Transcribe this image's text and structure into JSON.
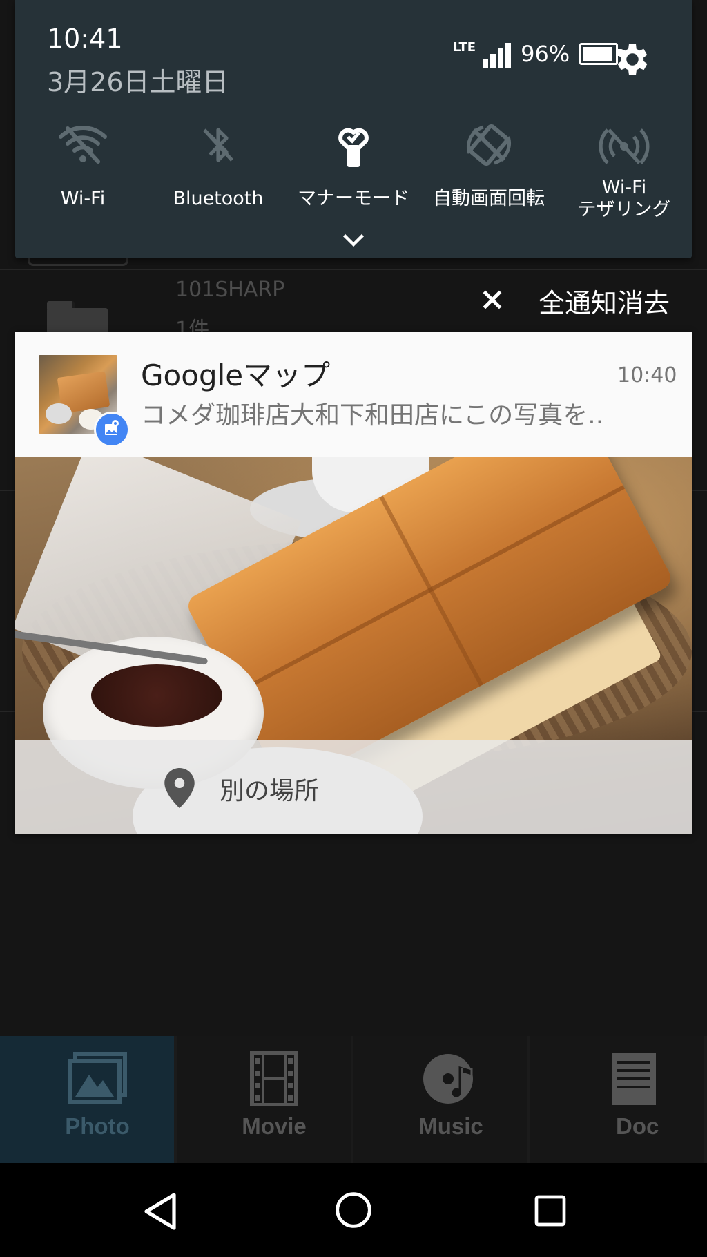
{
  "status": {
    "time": "10:41",
    "date": "3月26日土曜日",
    "network": "LTE",
    "battery_percent": "96%",
    "battery_level": 0.96
  },
  "quick_settings": {
    "tiles": [
      {
        "label": "Wi-Fi",
        "icon": "wifi-off-icon",
        "state": "off"
      },
      {
        "label": "Bluetooth",
        "icon": "bluetooth-off-icon",
        "state": "off"
      },
      {
        "label": "マナーモード",
        "icon": "manner-mode-icon",
        "state": "on"
      },
      {
        "label": "自動画面回転",
        "icon": "auto-rotate-off-icon",
        "state": "off"
      },
      {
        "label_line1": "Wi-Fi",
        "label_line2": "テザリング",
        "icon": "wifi-tethering-off-icon",
        "state": "off"
      }
    ]
  },
  "background_list": {
    "folder_name": "101SHARP",
    "folder_count": "1件"
  },
  "clear_all": {
    "label": "全通知消去"
  },
  "notification": {
    "app": "Googleマップ",
    "time": "10:40",
    "text": "コメダ珈琲店大和下和田店にこの写真を..",
    "action_label": "別の場所",
    "accent_color": "#4285f4"
  },
  "bottom_tabs": [
    {
      "label": "Photo",
      "icon": "photo-icon",
      "active": true
    },
    {
      "label": "Movie",
      "icon": "film-icon",
      "active": false
    },
    {
      "label": "Music",
      "icon": "music-disc-icon",
      "active": false
    },
    {
      "label": "Doc",
      "icon": "document-icon",
      "active": false
    }
  ],
  "nav": {
    "back": "back-icon",
    "home": "home-icon",
    "recents": "recents-icon"
  }
}
